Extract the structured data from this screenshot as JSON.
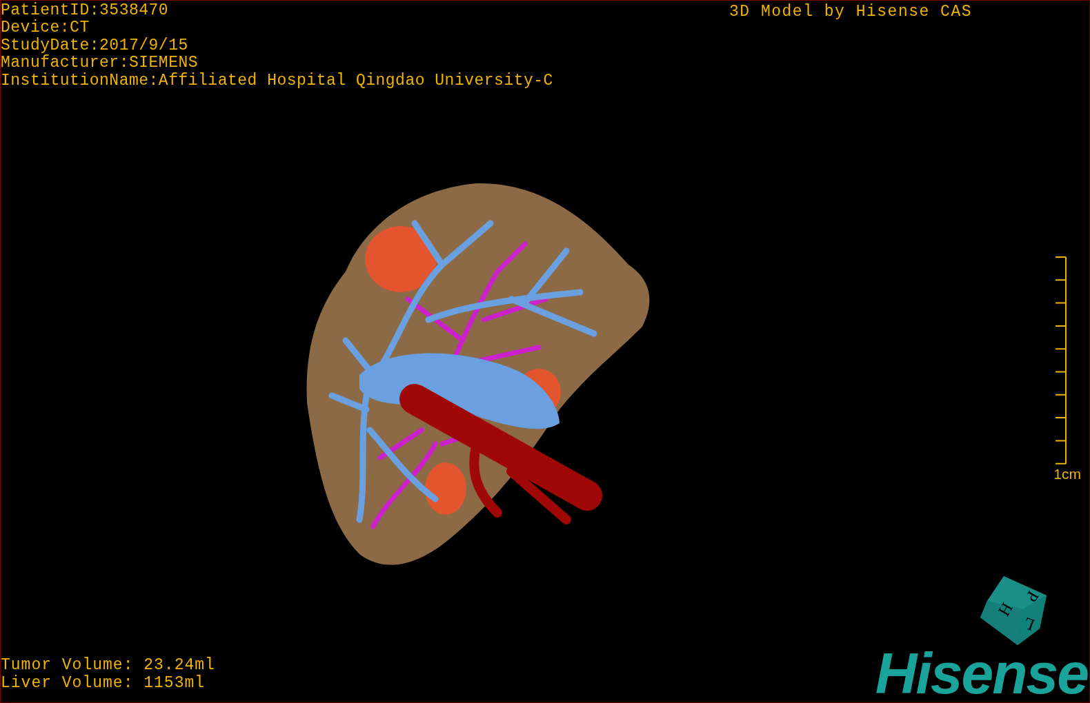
{
  "header": {
    "info_lines": [
      "PatientID:3538470",
      "Device:CT",
      "StudyDate:2017/9/15",
      "Manufacturer:SIEMENS",
      "InstitutionName:Affiliated Hospital Qingdao University-C"
    ],
    "title": "3D Model by Hisense CAS"
  },
  "scale_bar": {
    "label": "1cm"
  },
  "orientation_cube": {
    "labels": [
      "H",
      "P",
      "L"
    ]
  },
  "volumes": [
    "Tumor Volume: 23.24ml",
    "Liver Volume: 1153ml"
  ],
  "logo": {
    "text": "Hisense"
  }
}
